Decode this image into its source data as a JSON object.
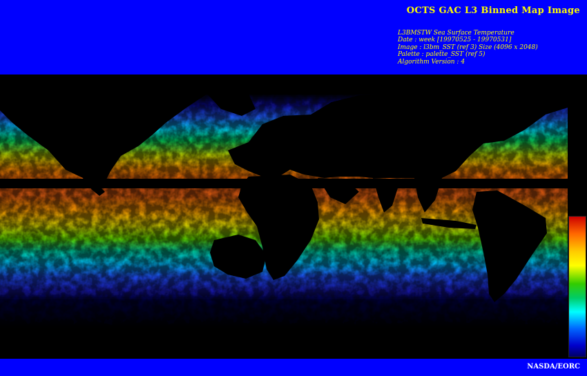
{
  "header": {
    "title": "OCTS GAC L3 Binned Map Image",
    "info": [
      "L3BMSTW Sea Surface Temperature",
      "Date : week [19970525 - 19970531]",
      "Image : l3bm_SST (ref 3) Size (4096 x 2048)",
      "Palette : palette_SST (ref 5)",
      "Algorithm Version : 4"
    ]
  },
  "footer": {
    "credit": "NASDA/EORC"
  },
  "colors": {
    "banner": "#0000ff",
    "title_text": "#ffff00",
    "credit_text": "#ffffff",
    "background": "#000000",
    "palette_stops": [
      "#cc0000",
      "#ff6600",
      "#ffcc00",
      "#ffff00",
      "#33cc00",
      "#00cc66",
      "#00ffff",
      "#0066ff",
      "#0000cc",
      "#000066"
    ]
  },
  "legend": {
    "type": "color-scale",
    "orientation": "vertical",
    "placement": "right"
  }
}
